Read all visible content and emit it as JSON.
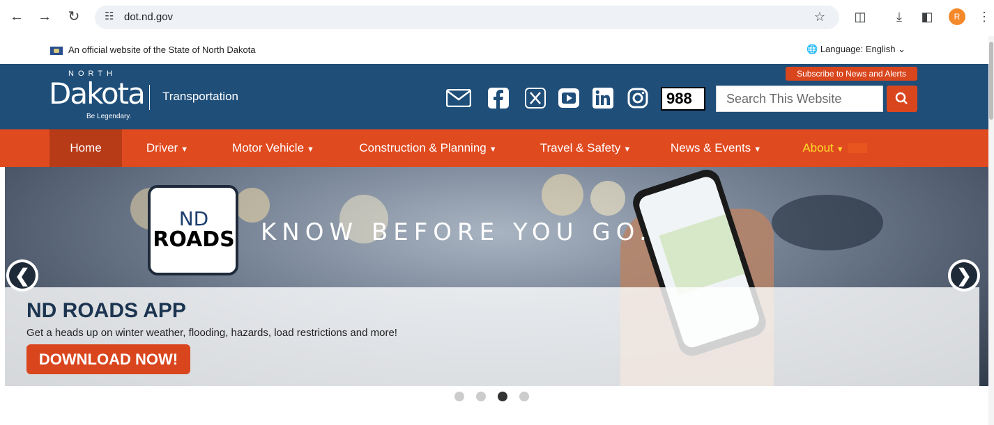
{
  "browser": {
    "url": "dot.nd.gov",
    "profile_initial": "R"
  },
  "official_banner": {
    "text": "An official website of the State of North Dakota",
    "language": "Language: English"
  },
  "header": {
    "logo_north": "NORTH",
    "logo_dakota": "Dakota",
    "logo_tagline": "Be Legendary.",
    "logo_department": "Transportation",
    "badge_988": "988",
    "subscribe_label": "Subscribe to News and Alerts",
    "search_placeholder": "Search This Website"
  },
  "nav": {
    "items": [
      {
        "label": "Home"
      },
      {
        "label": "Driver"
      },
      {
        "label": "Motor Vehicle"
      },
      {
        "label": "Construction & Planning"
      },
      {
        "label": "Travel & Safety"
      },
      {
        "label": "News & Events"
      },
      {
        "label": "About"
      }
    ]
  },
  "hero": {
    "logo_top": "ND",
    "logo_bottom": "ROADS",
    "tagline": "KNOW BEFORE YOU GO.",
    "title": "ND ROADS APP",
    "subtitle": "Get a heads up on winter weather, flooding, hazards, load restrictions and more!",
    "cta": "DOWNLOAD NOW!",
    "slide_count": 4,
    "active_slide": 3
  },
  "colors": {
    "header_blue": "#1f4e79",
    "nav_orange": "#e04a1f",
    "accent_orange": "#d9461e",
    "about_yellow": "#ffde2b"
  }
}
